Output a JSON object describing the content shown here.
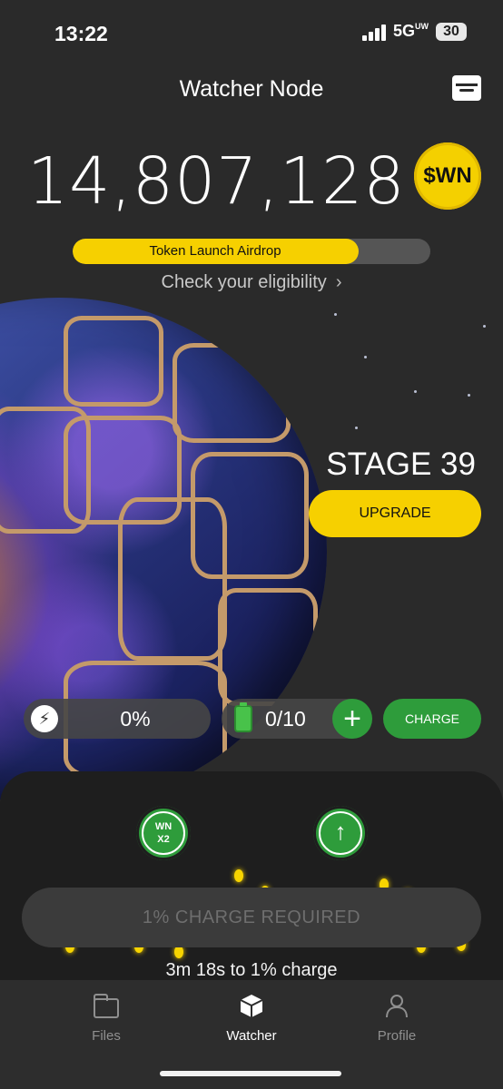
{
  "status_bar": {
    "time": "13:22",
    "network": "5G",
    "network_suffix": "UW",
    "battery": "30"
  },
  "header": {
    "title": "Watcher Node",
    "wallet_icon": "wallet-icon"
  },
  "balance": {
    "amount": "14,807,128",
    "token_label": "$WN"
  },
  "airdrop": {
    "label": "Token Launch Airdrop",
    "progress_fraction": 0.8,
    "check_label": "Check your eligibility",
    "chevron": "›"
  },
  "stage": {
    "label": "STAGE 39",
    "upgrade_label": "UPGRADE"
  },
  "stats": {
    "energy_icon": "bolt-icon",
    "energy_value": "0%",
    "battery_value": "0/10",
    "plus_label": "+",
    "charge_label": "CHARGE"
  },
  "panel": {
    "x2_line1": "WN",
    "x2_line2": "X2",
    "boost_icon": "arrow-up-icon",
    "required_label": "1% CHARGE REQUIRED",
    "countdown": "3m 18s to 1% charge"
  },
  "tabs": [
    {
      "label": "Files",
      "icon": "folder-icon",
      "active": false
    },
    {
      "label": "Watcher",
      "icon": "cube-icon",
      "active": true
    },
    {
      "label": "Profile",
      "icon": "person-icon",
      "active": false
    }
  ],
  "colors": {
    "accent_yellow": "#f6d000",
    "accent_green": "#2e9c3b",
    "background": "#2a2a2a",
    "panel": "#1e1e1e"
  }
}
